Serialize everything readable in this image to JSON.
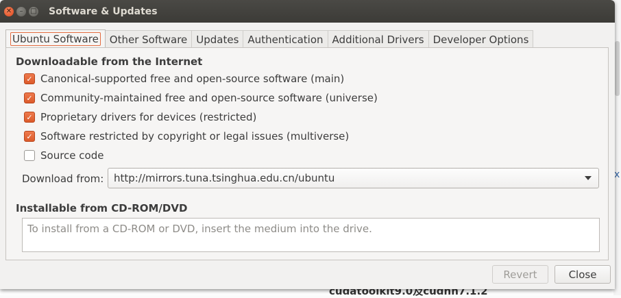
{
  "window": {
    "title": "Software & Updates"
  },
  "tabs": [
    {
      "label": "Ubuntu Software",
      "active": true
    },
    {
      "label": "Other Software"
    },
    {
      "label": "Updates"
    },
    {
      "label": "Authentication"
    },
    {
      "label": "Additional Drivers"
    },
    {
      "label": "Developer Options"
    }
  ],
  "downloadable": {
    "title": "Downloadable from the Internet",
    "items": [
      {
        "label": "Canonical-supported free and open-source software (main)",
        "checked": true
      },
      {
        "label": "Community-maintained free and open-source software (universe)",
        "checked": true
      },
      {
        "label": "Proprietary drivers for devices (restricted)",
        "checked": true
      },
      {
        "label": "Software restricted by copyright or legal issues (multiverse)",
        "checked": true
      },
      {
        "label": "Source code",
        "checked": false
      }
    ],
    "download_from_label": "Download from:",
    "download_from_value": "http://mirrors.tuna.tsinghua.edu.cn/ubuntu"
  },
  "cdrom": {
    "title": "Installable from CD-ROM/DVD",
    "placeholder": "To install from a CD-ROM or DVD, insert the medium into the drive."
  },
  "buttons": {
    "revert": "Revert",
    "close": "Close"
  },
  "background": {
    "bottom_text": "cudatoolkit9.0及cudnn7.1.2",
    "x_glyph": "x"
  },
  "colors": {
    "accent": "#dd5a2a",
    "titlebar": "#3c3b37"
  }
}
